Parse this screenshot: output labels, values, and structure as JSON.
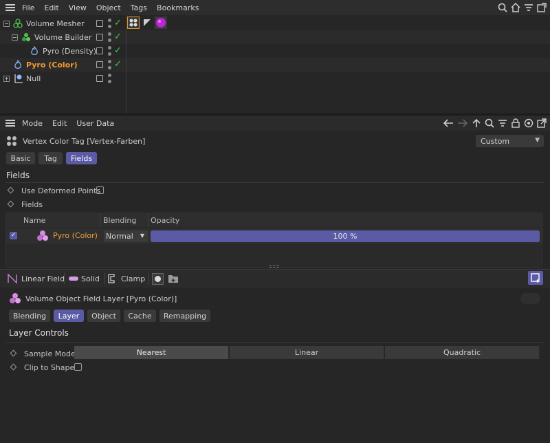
{
  "menubar": {
    "items": [
      "File",
      "Edit",
      "View",
      "Object",
      "Tags",
      "Bookmarks"
    ]
  },
  "objects": [
    {
      "name": "Volume Mesher",
      "icon": "volume-mesher-icon"
    },
    {
      "name": "Volume Builder",
      "icon": "volume-builder-icon"
    },
    {
      "name": "Pyro (Density)",
      "icon": "pyro-icon"
    },
    {
      "name": "Pyro (Color)",
      "icon": "pyro-icon"
    },
    {
      "name": "Null",
      "icon": "null-icon"
    }
  ],
  "attributes": {
    "menu": [
      "Mode",
      "Edit",
      "User Data"
    ],
    "tag_title": "Vertex Color Tag [Vertex-Farben]",
    "preset": "Custom",
    "tabs": [
      "Basic",
      "Tag",
      "Fields"
    ],
    "active_tab": "Fields",
    "section": "Fields",
    "use_deformed_points_label": "Use Deformed Points",
    "fields_label": "Fields"
  },
  "field_list": {
    "columns": [
      "Name",
      "Blending",
      "Opacity"
    ],
    "rows": [
      {
        "name": "Pyro (Color)",
        "blending": "Normal",
        "opacity": "100 %",
        "opacity_fraction": 1.0,
        "enabled": true
      }
    ]
  },
  "field_strip": {
    "buttons": [
      "Linear Field",
      "Solid",
      "Clamp"
    ]
  },
  "layer": {
    "title": "Volume Object Field Layer [Pyro (Color)]",
    "tabs": [
      "Blending",
      "Layer",
      "Object",
      "Cache",
      "Remapping"
    ],
    "active_tab": "Layer",
    "section": "Layer Controls",
    "sample_mode_label": "Sample Mode",
    "sample_modes": [
      "Nearest",
      "Linear",
      "Quadratic"
    ],
    "selected_mode": "Nearest",
    "clip_label": "Clip to Shape"
  },
  "colors": {
    "accent": "#5b5ba5",
    "highlight": "#f39a2e",
    "check": "#3ad13a"
  }
}
